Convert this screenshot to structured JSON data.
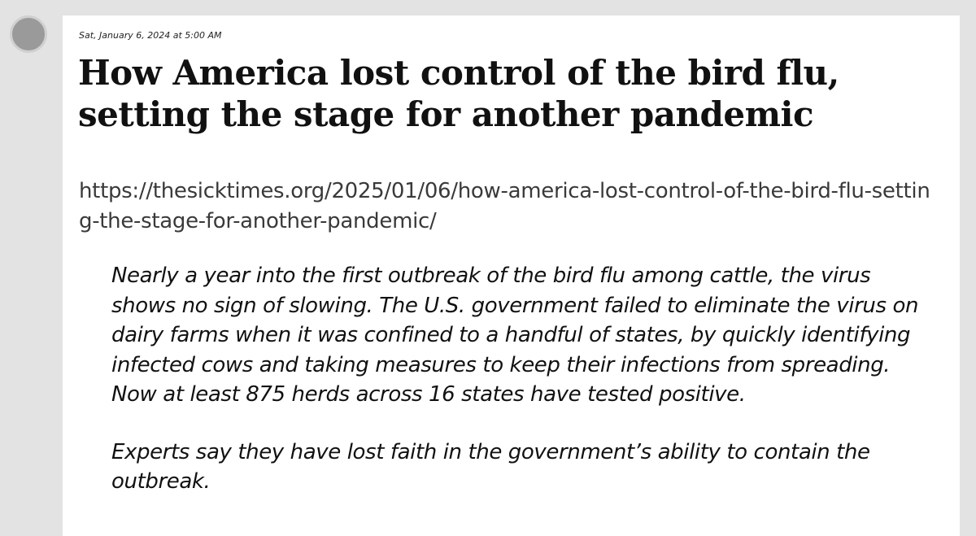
{
  "post": {
    "timestamp": "Sat, January 6, 2024 at 5:00 AM",
    "title": "How America lost control of the bird flu, setting the stage for another pandemic",
    "url": "https://thesicktimes.org/2025/01/06/how-america-lost-control-of-the-bird-flu-setting-the-stage-for-another-pandemic/",
    "quote_paragraphs": [
      "Nearly a year into the first outbreak of the bird flu among cattle, the virus shows no sign of slowing. The U.S. government failed to eliminate the virus on dairy farms when it was confined to a handful of states, by quickly identifying infected cows and taking measures to keep their infections from spreading. Now at least 875 herds across 16 states have tested positive.",
      "Experts say they have lost faith in the government’s ability to contain the outbreak."
    ]
  }
}
